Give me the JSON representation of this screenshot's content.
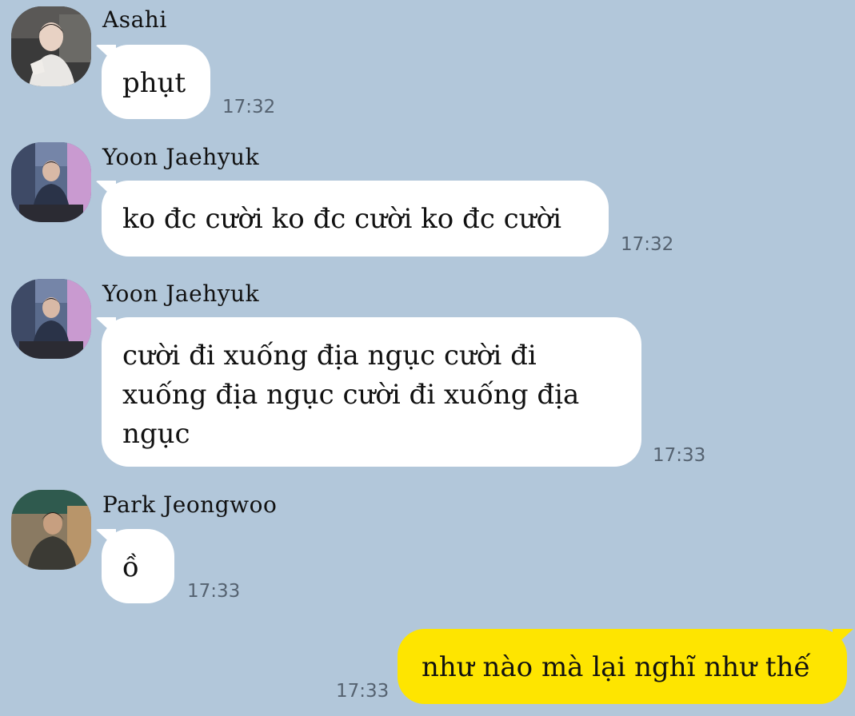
{
  "messages": [
    {
      "sender": "Asahi",
      "text": "phụt",
      "time": "17:32",
      "avatar": "asahi-avatar"
    },
    {
      "sender": "Yoon Jaehyuk",
      "text": "ko đc cười ko đc cười ko đc cười",
      "time": "17:32",
      "avatar": "jaehyuk-avatar"
    },
    {
      "sender": "Yoon Jaehyuk",
      "text_lines": [
        "cười đi xuống địa ngục cười đi",
        "xuống địa ngục cười đi xuống địa",
        "ngục"
      ],
      "time": "17:33",
      "avatar": "jaehyuk-avatar"
    },
    {
      "sender": "Park Jeongwoo",
      "text": "ồ",
      "time": "17:33",
      "avatar": "jeongwoo-avatar"
    }
  ],
  "my_message": {
    "text": "như nào mà lại nghĩ như thế",
    "time": "17:33"
  },
  "colors": {
    "background": "#b2c7da",
    "incoming_bubble": "#ffffff",
    "outgoing_bubble": "#fee500",
    "time_text": "#556270"
  }
}
